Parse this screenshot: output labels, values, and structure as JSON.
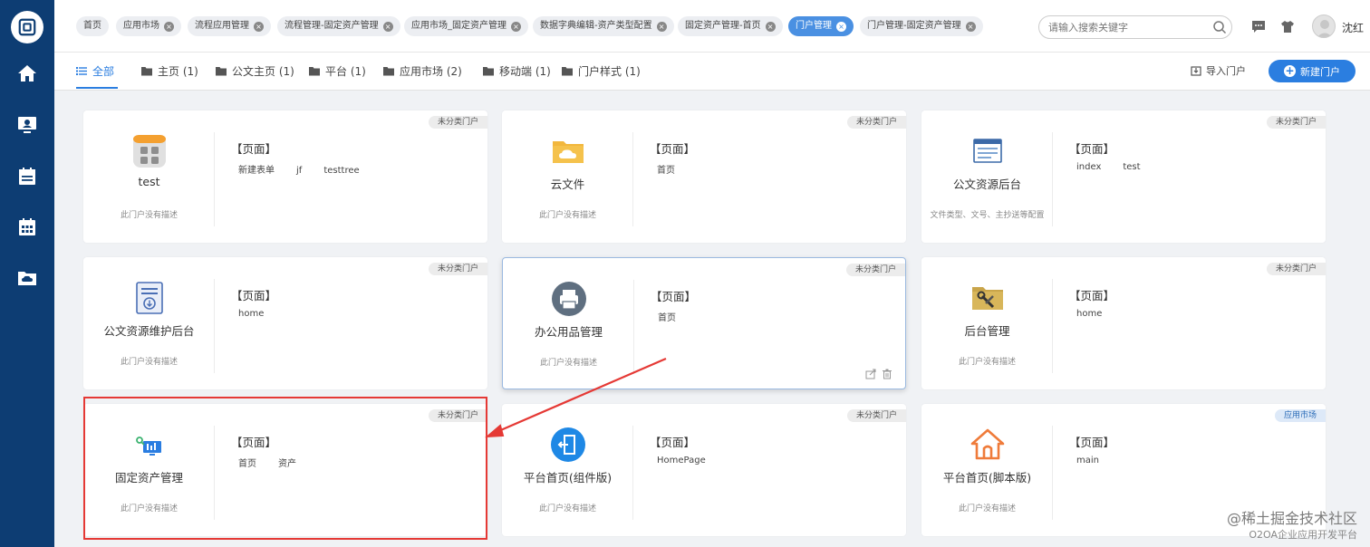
{
  "topbar": {
    "tabs": [
      {
        "label": "首页",
        "closable": false,
        "active": false
      },
      {
        "label": "应用市场",
        "closable": true,
        "active": false
      },
      {
        "label": "流程应用管理",
        "closable": true,
        "active": false
      },
      {
        "label": "流程管理-固定资产管理",
        "closable": true,
        "active": false
      },
      {
        "label": "应用市场_固定资产管理",
        "closable": true,
        "active": false
      },
      {
        "label": "数据字典编辑-资产类型配置",
        "closable": true,
        "active": false
      },
      {
        "label": "固定资产管理-首页",
        "closable": true,
        "active": false
      },
      {
        "label": "门户管理",
        "closable": true,
        "active": true
      },
      {
        "label": "门户管理-固定资产管理",
        "closable": true,
        "active": false
      }
    ],
    "search_placeholder": "请输入搜索关键字",
    "username": "沈红"
  },
  "categories": {
    "items": [
      {
        "label": "全部",
        "active": true
      },
      {
        "label": "主页 (1)"
      },
      {
        "label": "公文主页 (1)"
      },
      {
        "label": "平台 (1)"
      },
      {
        "label": "应用市场 (2)"
      },
      {
        "label": "移动端 (1)"
      },
      {
        "label": "门户样式 (1)"
      }
    ],
    "import_label": "导入门户",
    "new_label": "新建门户"
  },
  "cards": [
    {
      "name": "test",
      "desc": "此门户没有描述",
      "badge": "未分类门户",
      "pages_title": "【页面】",
      "pages": [
        "新建表单",
        "jf",
        "testtree"
      ],
      "icon": "app-grid-icon"
    },
    {
      "name": "云文件",
      "desc": "此门户没有描述",
      "badge": "未分类门户",
      "pages_title": "【页面】",
      "pages": [
        "首页"
      ],
      "icon": "cloud-folder-icon"
    },
    {
      "name": "公文资源后台",
      "desc": "文件类型、文号、主抄送等配置",
      "badge": "未分类门户",
      "pages_title": "【页面】",
      "pages": [
        "index",
        "test"
      ],
      "icon": "browser-window-icon"
    },
    {
      "name": "公文资源维护后台",
      "desc": "此门户没有描述",
      "badge": "未分类门户",
      "pages_title": "【页面】",
      "pages": [
        "home"
      ],
      "icon": "document-stamp-icon"
    },
    {
      "name": "办公用品管理",
      "desc": "此门户没有描述",
      "badge": "未分类门户",
      "pages_title": "【页面】",
      "pages": [
        "首页"
      ],
      "icon": "printer-icon"
    },
    {
      "name": "后台管理",
      "desc": "此门户没有描述",
      "badge": "未分类门户",
      "pages_title": "【页面】",
      "pages": [
        "home"
      ],
      "icon": "tools-folder-icon"
    },
    {
      "name": "固定资产管理",
      "desc": "此门户没有描述",
      "badge": "未分类门户",
      "pages_title": "【页面】",
      "pages": [
        "首页",
        "资产"
      ],
      "icon": "asset-monitor-icon"
    },
    {
      "name": "平台首页(组件版)",
      "desc": "此门户没有描述",
      "badge": "未分类门户",
      "pages_title": "【页面】",
      "pages": [
        "HomePage"
      ],
      "icon": "exit-door-icon"
    },
    {
      "name": "平台首页(脚本版)",
      "desc": "此门户没有描述",
      "badge": "应用市场",
      "pages_title": "【页面】",
      "pages": [
        "main"
      ],
      "icon": "house-icon"
    }
  ],
  "watermark": {
    "line1": "@稀土掘金技术社区",
    "line2": "O2OA企业应用开发平台"
  }
}
